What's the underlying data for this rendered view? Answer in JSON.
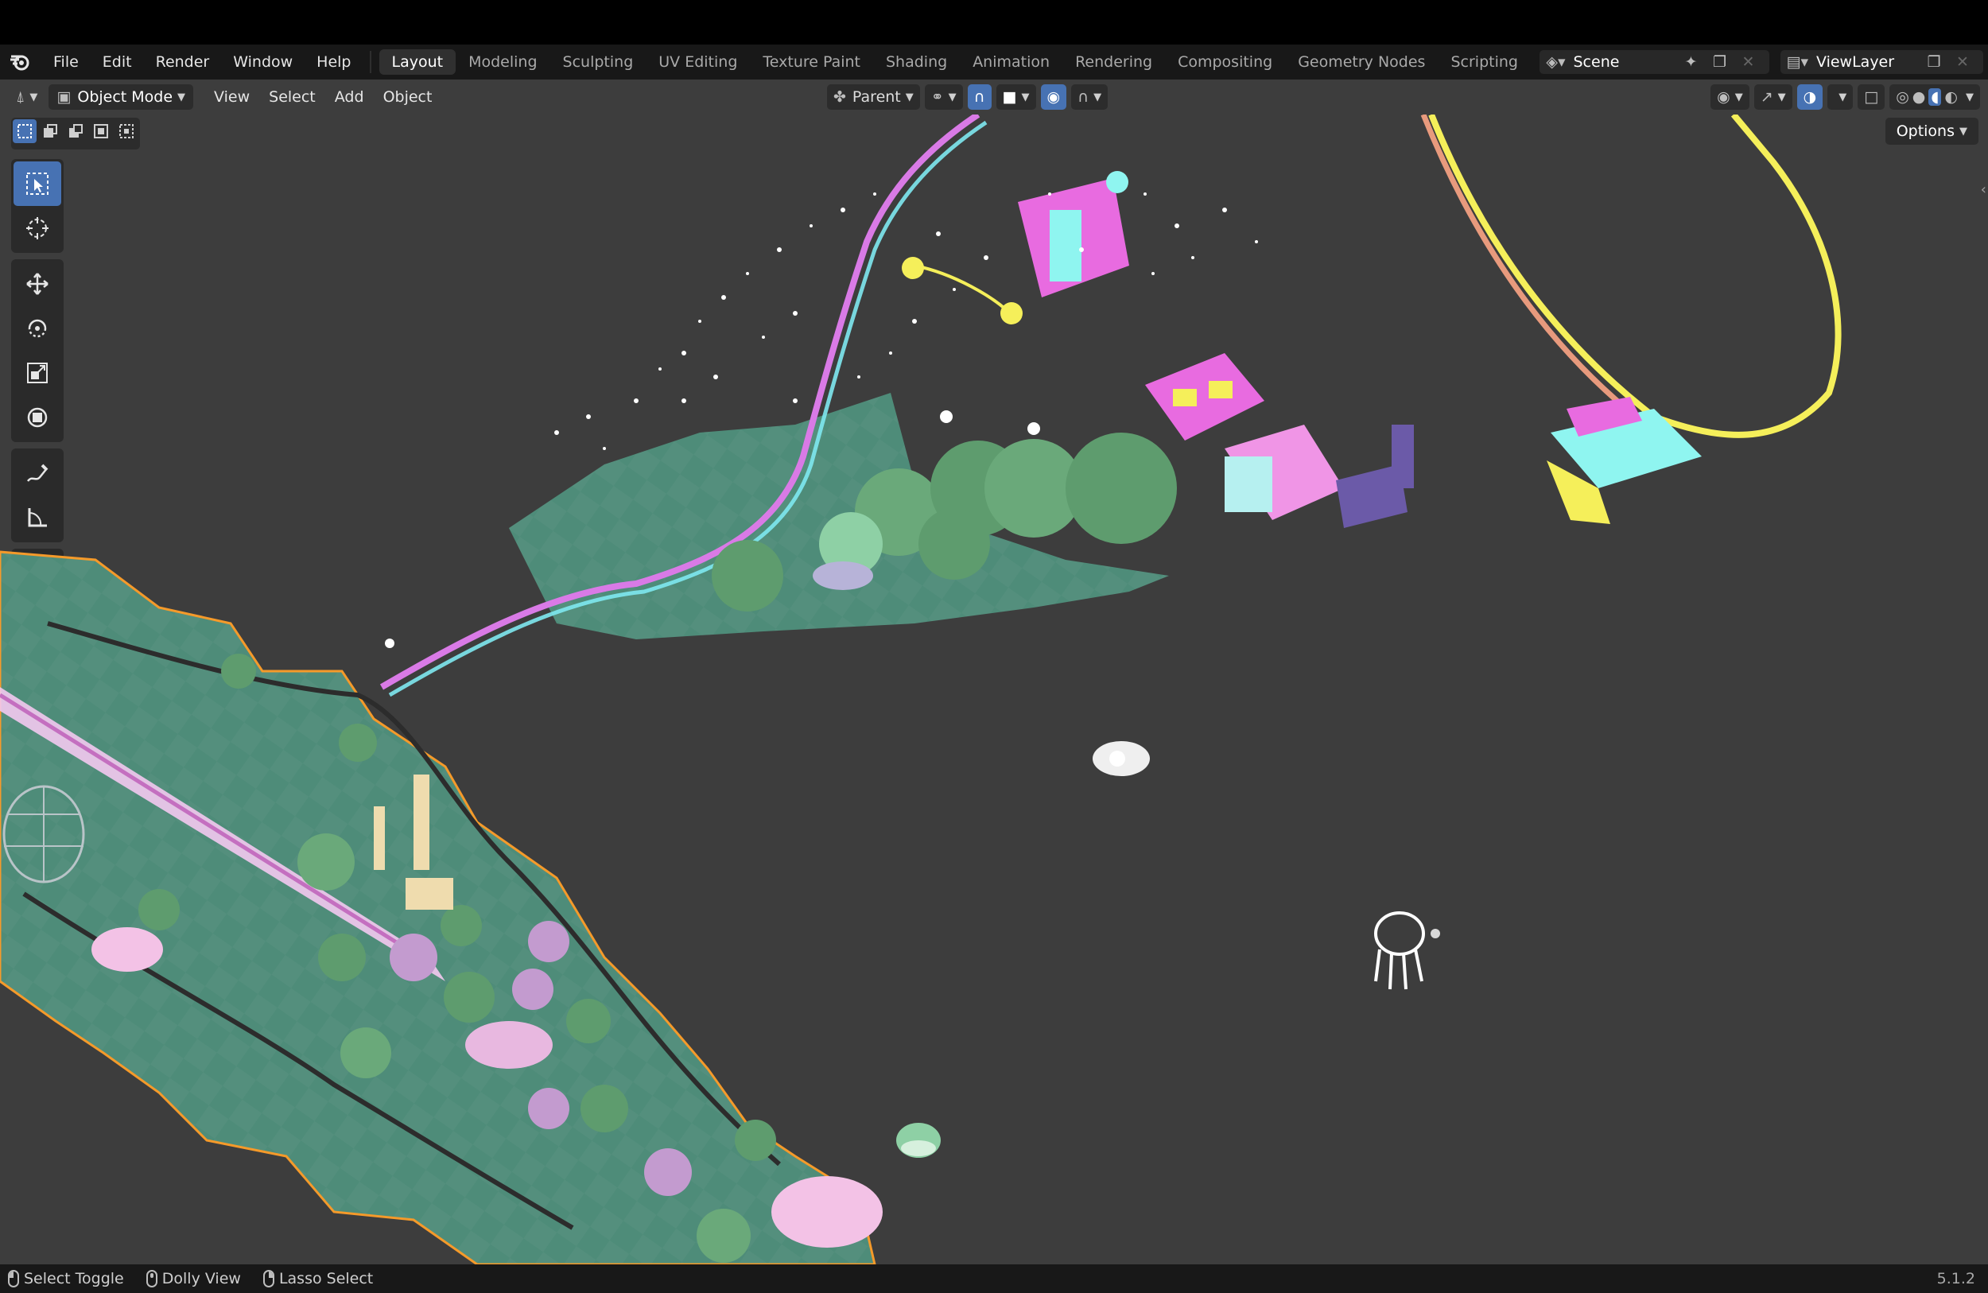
{
  "menu": {
    "items": [
      "File",
      "Edit",
      "Render",
      "Window",
      "Help"
    ]
  },
  "workspaces": {
    "tabs": [
      "Layout",
      "Modeling",
      "Sculpting",
      "UV Editing",
      "Texture Paint",
      "Shading",
      "Animation",
      "Rendering",
      "Compositing",
      "Geometry Nodes",
      "Scripting"
    ],
    "active": "Layout",
    "add_symbol": "+"
  },
  "scene": {
    "name": "Scene"
  },
  "view_layer": {
    "name": "ViewLayer"
  },
  "viewport_header": {
    "mode": "Object Mode",
    "menus": [
      "View",
      "Select",
      "Add",
      "Object"
    ],
    "pivot": "Parent"
  },
  "options_label": "Options",
  "status_bar": {
    "hints": [
      {
        "label": "Select Toggle",
        "mouse": "left"
      },
      {
        "label": "Dolly View",
        "mouse": "mid"
      },
      {
        "label": "Lasso Select",
        "mouse": "right"
      }
    ],
    "version": "5.1.2"
  },
  "colors": {
    "accent": "#4772b3",
    "ground": "#4e8c79",
    "selection_outline": "#f59a2a",
    "tree": "#5e9c6e",
    "pink": "#e86be0",
    "cyan": "#8ff5f0",
    "yellow": "#f5ef5a"
  },
  "icons": {
    "logo": "blender-logo-icon",
    "tools": [
      "select-box-icon",
      "cursor-icon",
      "move-icon",
      "rotate-icon",
      "scale-icon",
      "transform-icon",
      "annotate-icon",
      "measure-icon",
      "add-cube-icon"
    ]
  }
}
